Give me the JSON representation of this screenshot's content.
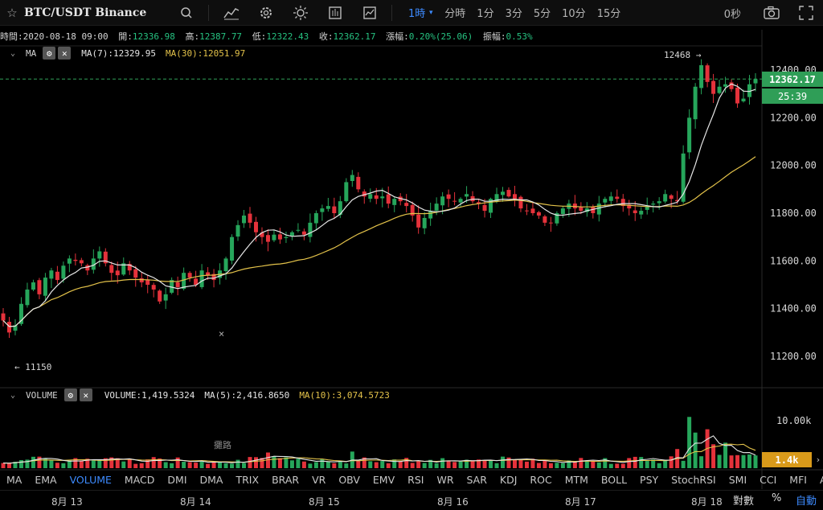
{
  "toolbar": {
    "symbol": "BTC/USDT Binance",
    "timeframes": [
      "1時",
      "分時",
      "1分",
      "3分",
      "5分",
      "10分",
      "15分"
    ],
    "countdown": "0秒",
    "icons": [
      "star-icon",
      "search-icon",
      "chart-type-icon",
      "settings-icon",
      "theme-icon",
      "template-icon",
      "indicator-icon",
      "camera-icon",
      "fullscreen-icon"
    ]
  },
  "info": {
    "time_label": "時間:",
    "time": "2020-08-18 09:00",
    "open_label": "開:",
    "open": "12336.98",
    "high_label": "高:",
    "high": "12387.77",
    "low_label": "低:",
    "low": "12322.43",
    "close_label": "收:",
    "close": "12362.17",
    "change_label": "漲幅:",
    "change": "0.20%(25.06)",
    "amp_label": "振幅:",
    "amp": "0.53%"
  },
  "ma_indicator": {
    "name": "MA",
    "ma7": "MA(7):12329.95",
    "ma30": "MA(30):12051.97",
    "settings_glyph": "⚙",
    "close_glyph": "✕"
  },
  "volume_indicator": {
    "name": "VOLUME",
    "volume": "VOLUME:1,419.5324",
    "ma5": "MA(5):2,416.8650",
    "ma10": "MA(10):3,074.5723",
    "settings_glyph": "⚙",
    "close_glyph": "✕"
  },
  "price_axis": [
    "12400.00",
    "12200.00",
    "12000.00",
    "11800.00",
    "11600.00",
    "11400.00",
    "11200.00"
  ],
  "volume_axis": [
    "10.00k"
  ],
  "current_price_tag": "12362.17",
  "countdown_tag": "25:39",
  "volume_tag": "1.4k",
  "high_marker": "12468",
  "low_marker": "← 11150",
  "watermark": "攤路",
  "indicator_tabs": [
    "MA",
    "EMA",
    "VOLUME",
    "MACD",
    "DMI",
    "DMA",
    "TRIX",
    "BRAR",
    "VR",
    "OBV",
    "EMV",
    "RSI",
    "WR",
    "SAR",
    "KDJ",
    "ROC",
    "MTM",
    "BOLL",
    "PSY",
    "StochRSI",
    "SMI",
    "CCI",
    "MFI",
    "ATR"
  ],
  "active_indicator": "VOLUME",
  "dates": [
    "8月 13",
    "8月 14",
    "8月 15",
    "8月 16",
    "8月 17",
    "8月 18"
  ],
  "scale_options": {
    "log": "對數",
    "percent": "%",
    "auto": "自動"
  },
  "colors": {
    "up": "#26a65b",
    "down": "#e5323b",
    "ma7": "#e6e6e6",
    "ma30": "#e3c24a",
    "accent": "#3d8bff",
    "price_tag": "#2f9e57",
    "volume_tag": "#d99a1a"
  },
  "chart_data": {
    "type": "candlestick",
    "timeframe": "1h",
    "ylim": [
      11100,
      12500
    ],
    "high_point": 12468,
    "low_point": 11150,
    "last_price": 12362.17,
    "ma7_last": 12329.95,
    "ma30_last": 12051.97,
    "volume_ylim": [
      0,
      11000
    ],
    "volume_last": 1419.5324,
    "volume_ma5_last": 2416.865,
    "volume_ma10_last": 3074.5723,
    "x_ticks": [
      "8月 13",
      "8月 14",
      "8月 15",
      "8月 16",
      "8月 17",
      "8月 18"
    ],
    "close_trace": [
      11350,
      11300,
      11330,
      11420,
      11480,
      11510,
      11460,
      11530,
      11560,
      11520,
      11580,
      11610,
      11600,
      11590,
      11560,
      11610,
      11640,
      11590,
      11550,
      11540,
      11590,
      11560,
      11530,
      11510,
      11500,
      11480,
      11430,
      11460,
      11520,
      11490,
      11550,
      11530,
      11500,
      11560,
      11540,
      11520,
      11560,
      11610,
      11700,
      11750,
      11790,
      11760,
      11720,
      11700,
      11680,
      11710,
      11690,
      11700,
      11720,
      11730,
      11710,
      11760,
      11800,
      11820,
      11830,
      11800,
      11850,
      11930,
      11960,
      11900,
      11870,
      11880,
      11860,
      11870,
      11840,
      11860,
      11850,
      11830,
      11790,
      11740,
      11780,
      11810,
      11840,
      11870,
      11860,
      11850,
      11860,
      11880,
      11850,
      11840,
      11810,
      11860,
      11880,
      11890,
      11870,
      11860,
      11820,
      11810,
      11800,
      11790,
      11760,
      11760,
      11800,
      11820,
      11840,
      11820,
      11810,
      11820,
      11800,
      11840,
      11860,
      11870,
      11860,
      11830,
      11820,
      11800,
      11810,
      11830,
      11840,
      11850,
      11880,
      11860,
      11850,
      12050,
      12200,
      12330,
      12420,
      12350,
      12300,
      12330,
      12340,
      12320,
      12260,
      12280,
      12340,
      12362
    ]
  }
}
